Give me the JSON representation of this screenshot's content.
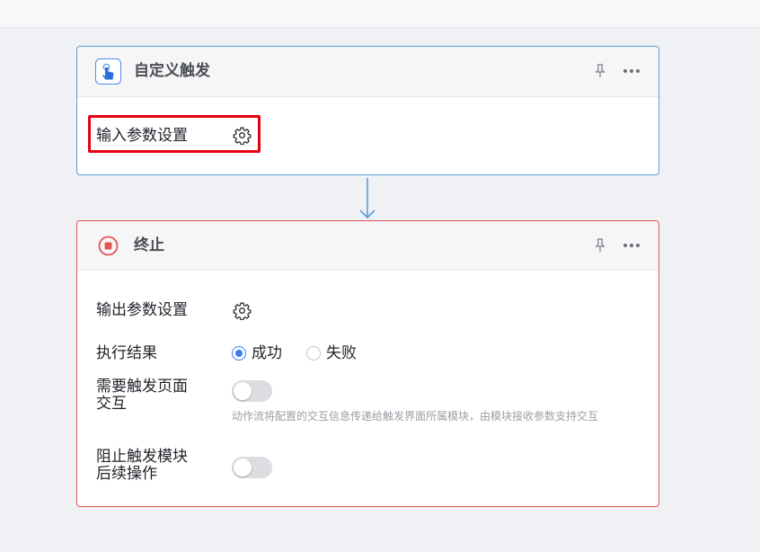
{
  "trigger_card": {
    "title": "自定义触发",
    "icon": "touch-hand-icon",
    "input_params_label": "输入参数设置"
  },
  "end_card": {
    "title": "终止",
    "icon": "stop-circle-icon",
    "output_params_label": "输出参数设置",
    "result": {
      "label": "执行结果",
      "options": [
        "成功",
        "失败"
      ],
      "selected": "成功"
    },
    "need_interaction": {
      "label": "需要触发页面交互",
      "enabled": false,
      "hint": "动作流将配置的交互信息传递给触发界面所属模块，由模块接收参数支持交互"
    },
    "block_followup": {
      "label": "阻止触发模块后续操作",
      "enabled": false
    }
  },
  "colors": {
    "trigger_border": "#5b9bd5",
    "end_border": "#e25555",
    "highlight": "#e60012",
    "accent": "#3a7bf5",
    "toggle_off": "#dcdde0"
  }
}
